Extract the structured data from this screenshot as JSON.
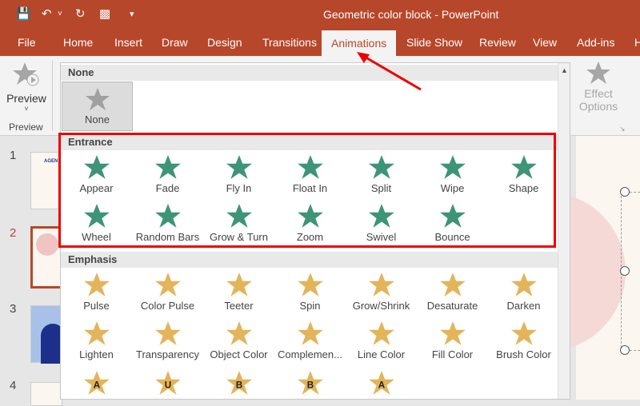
{
  "window": {
    "title": "Geometric color block  -  PowerPoint"
  },
  "qat": {
    "save": "save-icon",
    "undo": "undo-icon",
    "redo": "redo-icon",
    "present": "present-from-start-icon",
    "customize": "▾"
  },
  "tabs": [
    "File",
    "Home",
    "Insert",
    "Draw",
    "Design",
    "Transitions",
    "Animations",
    "Slide Show",
    "Review",
    "View",
    "Add-ins",
    "H"
  ],
  "active_tab": "Animations",
  "ribbon": {
    "preview_label": "Preview",
    "preview_group": "Preview",
    "effect_options_line1": "Effect",
    "effect_options_line2": "Options"
  },
  "slides": [
    "1",
    "2",
    "3",
    "4"
  ],
  "selected_slide": "2",
  "gallery": {
    "none_header": "None",
    "none_item": "None",
    "entrance_header": "Entrance",
    "entrance": [
      "Appear",
      "Fade",
      "Fly In",
      "Float In",
      "Split",
      "Wipe",
      "Shape",
      "Wheel",
      "Random Bars",
      "Grow & Turn",
      "Zoom",
      "Swivel",
      "Bounce"
    ],
    "emphasis_header": "Emphasis",
    "emphasis": [
      "Pulse",
      "Color Pulse",
      "Teeter",
      "Spin",
      "Grow/Shrink",
      "Desaturate",
      "Darken",
      "Lighten",
      "Transparency",
      "Object Color",
      "Complemen...",
      "Line Color",
      "Fill Color",
      "Brush Color"
    ],
    "emphasis_more_letters": [
      "A",
      "U",
      "B",
      "B",
      "A"
    ]
  },
  "colors": {
    "brand": "#b7472a",
    "entrance": "#3e9476",
    "emphasis": "#e3b45a",
    "highlight": "#e00000"
  }
}
